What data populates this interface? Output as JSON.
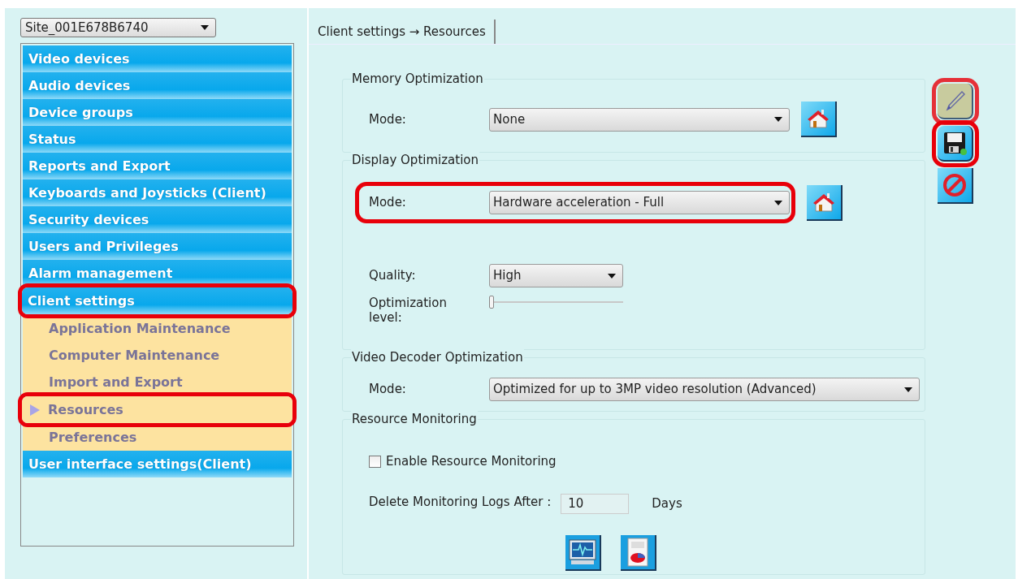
{
  "site_selector": {
    "value": "Site_001E678B6740"
  },
  "sidebar": {
    "items": [
      {
        "label": "Video devices",
        "selected": false,
        "highlighted": false
      },
      {
        "label": "Audio devices",
        "selected": false,
        "highlighted": false
      },
      {
        "label": "Device groups",
        "selected": false,
        "highlighted": false
      },
      {
        "label": "Status",
        "selected": false,
        "highlighted": false
      },
      {
        "label": "Reports and Export",
        "selected": false,
        "highlighted": false
      },
      {
        "label": "Keyboards and Joysticks (Client)",
        "selected": false,
        "highlighted": false
      },
      {
        "label": "Security devices",
        "selected": false,
        "highlighted": false
      },
      {
        "label": "Users and Privileges",
        "selected": false,
        "highlighted": false
      },
      {
        "label": "Alarm management",
        "selected": false,
        "highlighted": false
      },
      {
        "label": "Client settings",
        "selected": false,
        "highlighted": true,
        "children": [
          {
            "label": "Application Maintenance",
            "selected": false,
            "highlighted": false
          },
          {
            "label": "Computer Maintenance",
            "selected": false,
            "highlighted": false
          },
          {
            "label": "Import and Export",
            "selected": false,
            "highlighted": false
          },
          {
            "label": "Resources",
            "selected": true,
            "highlighted": true
          },
          {
            "label": "Preferences",
            "selected": false,
            "highlighted": false
          }
        ]
      },
      {
        "label": "User interface settings(Client)",
        "selected": false,
        "highlighted": false
      }
    ]
  },
  "tab": {
    "label": "Client settings → Resources",
    "selected": true
  },
  "sections": [
    {
      "title": "Memory Optimization",
      "rows": [
        {
          "kind": "select",
          "label": "Mode:",
          "value": "None",
          "reset_button": true,
          "highlighted": false
        }
      ]
    },
    {
      "title": "Display Optimization",
      "rows": [
        {
          "kind": "select",
          "label": "Mode:",
          "value": "Hardware acceleration - Full",
          "reset_button": true,
          "highlighted": true
        },
        {
          "kind": "select",
          "label": "Quality:",
          "value": "High",
          "reset_button": false,
          "highlighted": false
        },
        {
          "kind": "slider",
          "label": "Optimization level:",
          "level": 0
        }
      ]
    },
    {
      "title": "Video Decoder Optimization",
      "rows": [
        {
          "kind": "select",
          "label": "Mode:",
          "value": "Optimized for up to 3MP video resolution (Advanced)",
          "reset_button": false,
          "highlighted": false
        }
      ]
    },
    {
      "title": "Resource Monitoring",
      "rows": [
        {
          "kind": "checkbox",
          "label": "Enable Resource Monitoring",
          "checked": false
        },
        {
          "kind": "number",
          "label": "Delete Monitoring Logs After :",
          "value": "10",
          "unit": "Days"
        },
        {
          "kind": "tool_buttons"
        }
      ]
    }
  ],
  "actions": [
    {
      "kind": "edit",
      "disabled": true,
      "highlighted": true
    },
    {
      "kind": "save",
      "disabled": false,
      "highlighted": true
    },
    {
      "kind": "cancel",
      "disabled": false,
      "highlighted": false
    }
  ]
}
